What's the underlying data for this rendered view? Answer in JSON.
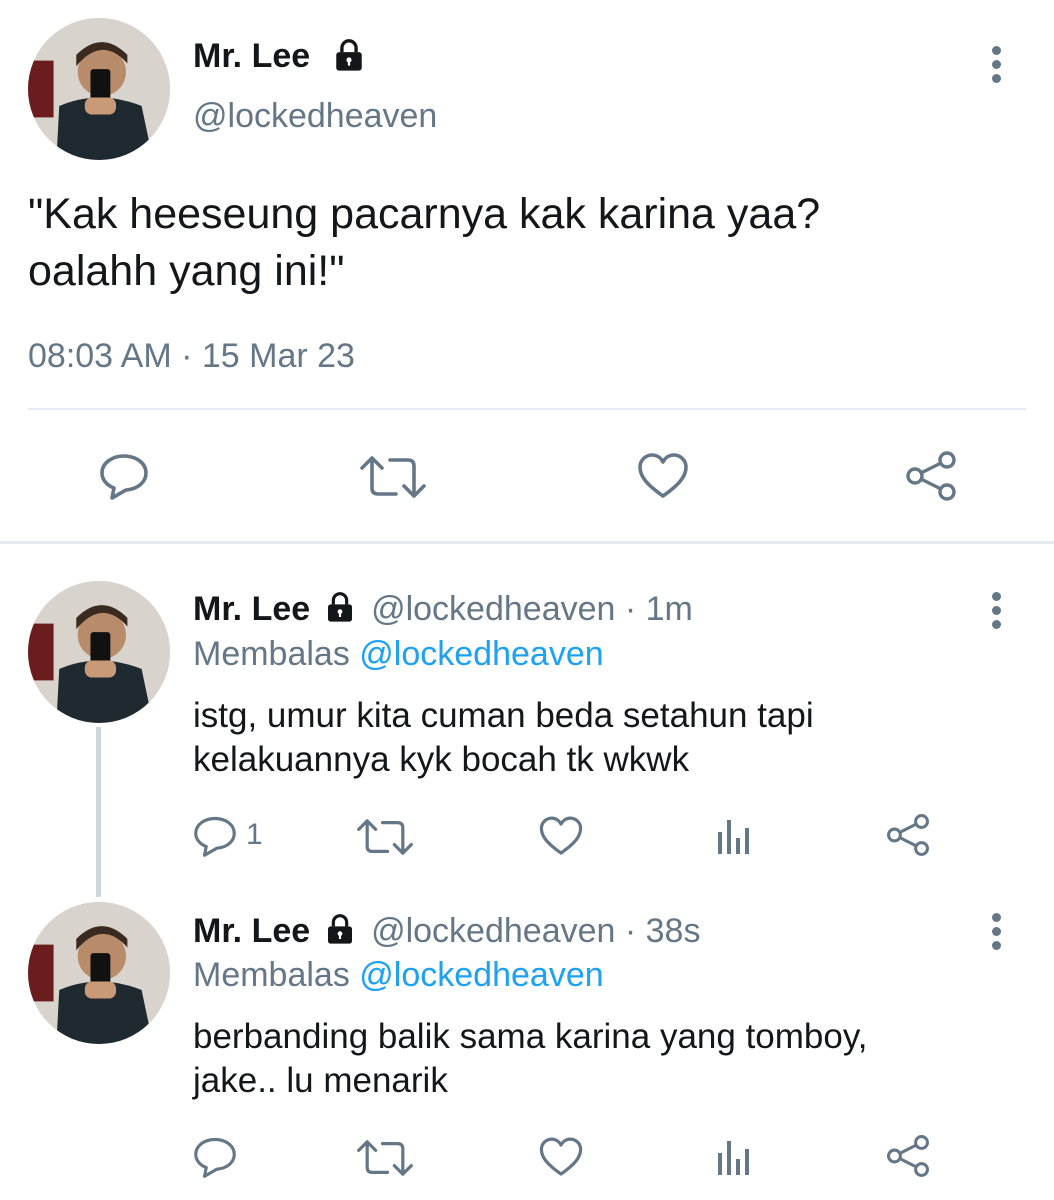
{
  "main_tweet": {
    "author_name": "Mr. Lee",
    "author_handle": "@lockedheaven",
    "text_line1": "\"Kak heeseung pacarnya kak karina yaa?",
    "text_line2": "oalahh yang ini!\"",
    "timestamp": "08:03 AM · 15 Mar 23"
  },
  "replies": [
    {
      "author_name": "Mr. Lee",
      "author_handle": "@lockedheaven",
      "age": "· 1m",
      "replying_prefix": "Membalas",
      "replying_to": "@lockedheaven",
      "text_line1": "istg, umur kita cuman beda setahun tapi",
      "text_line2": "kelakuannya kyk bocah tk wkwk",
      "reply_count": "1"
    },
    {
      "author_name": "Mr. Lee",
      "author_handle": "@lockedheaven",
      "age": "· 38s",
      "replying_prefix": "Membalas",
      "replying_to": "@lockedheaven",
      "text_line1": "berbanding balik sama karina yang tomboy,",
      "text_line2": "jake.. lu menarik",
      "reply_count": ""
    }
  ],
  "icons": {
    "reply": "reply-icon",
    "retweet": "retweet-icon",
    "like": "heart-icon",
    "analytics": "analytics-icon",
    "share": "share-icon",
    "more": "more-icon",
    "lock": "lock-icon"
  },
  "colors": {
    "text": "#14171a",
    "secondary": "#657786",
    "accent": "#1da1f2",
    "divider": "#e6ecf0"
  }
}
